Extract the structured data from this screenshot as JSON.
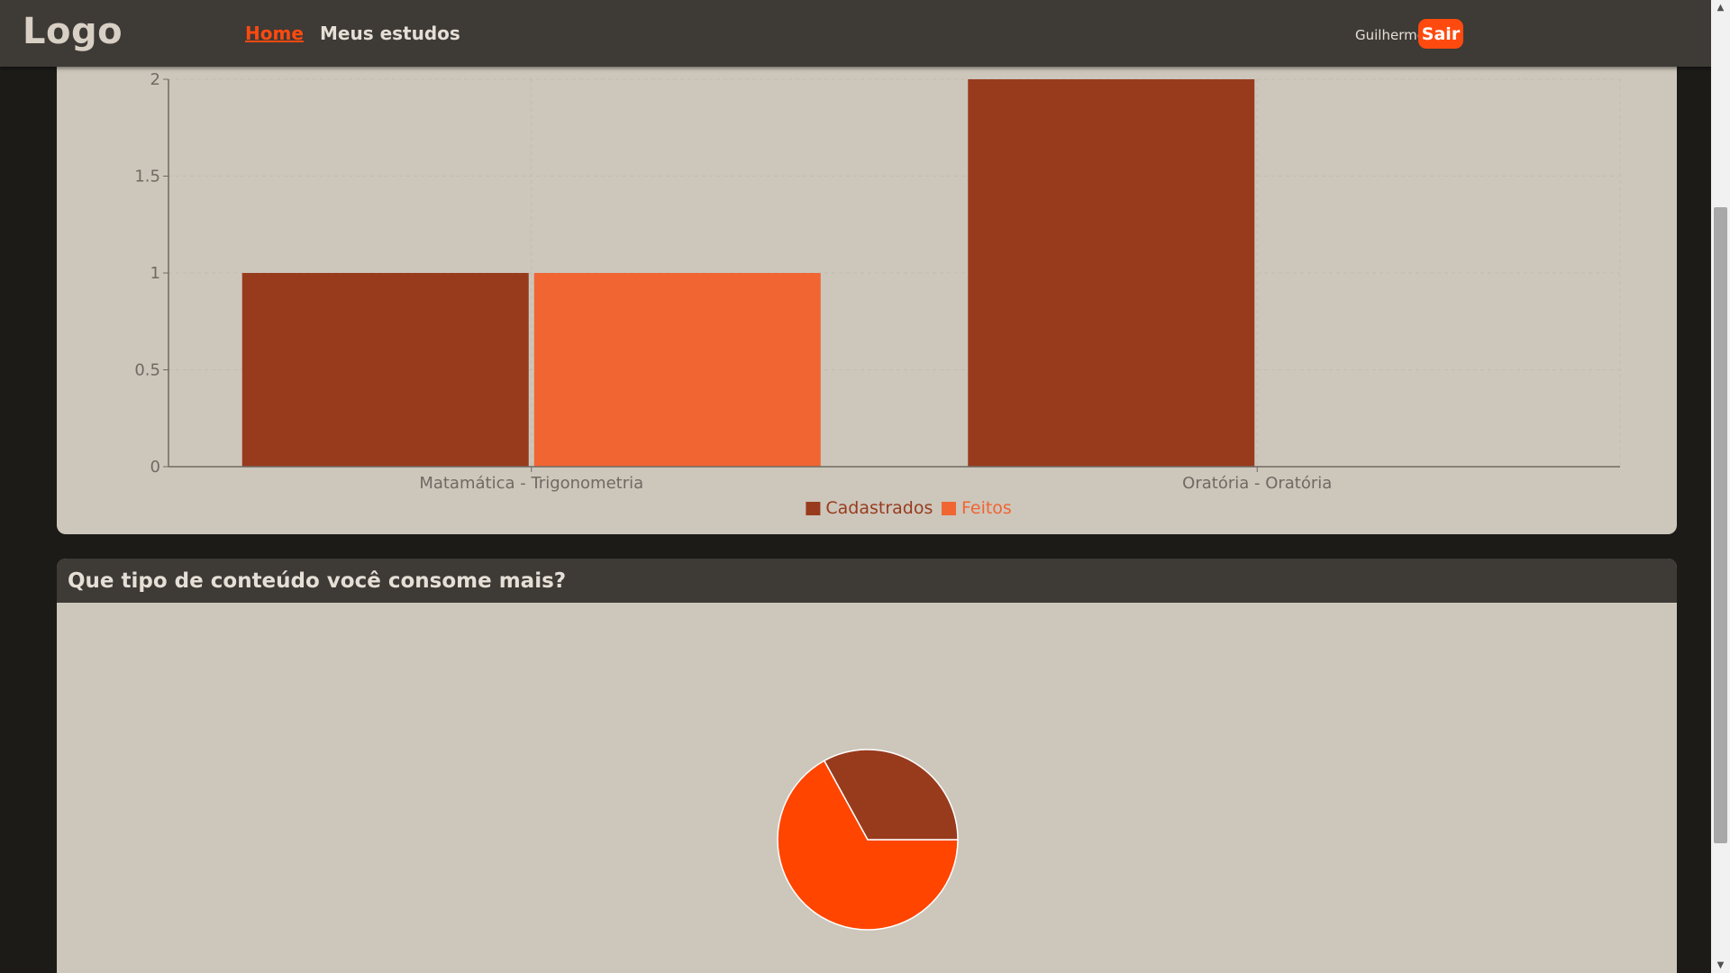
{
  "nav": {
    "logo": "Logo",
    "links": [
      {
        "label": "Home",
        "active": true
      },
      {
        "label": "Meus estudos",
        "active": false
      }
    ],
    "user_name": "Guilherme",
    "logout_label": "Sair"
  },
  "pie_card": {
    "title": "Que tipo de conteúdo você consome mais?"
  },
  "colors": {
    "cadastrados": "#983b1d",
    "feitos": "#f06532",
    "accent": "#ff4a0f",
    "pie_main": "#ff4500",
    "pie_secondary": "#983b1d"
  },
  "chart_data": [
    {
      "type": "bar",
      "categories": [
        "Matamática - Trigonometria",
        "Oratória - Oratória"
      ],
      "series": [
        {
          "name": "Cadastrados",
          "values": [
            1,
            2
          ]
        },
        {
          "name": "Feitos",
          "values": [
            1,
            0
          ]
        }
      ],
      "yticks": [
        "0",
        "0.5",
        "1",
        "1.5",
        "2"
      ],
      "ylim": [
        0,
        2
      ],
      "grid": true,
      "legend": "bottom-center"
    },
    {
      "type": "pie",
      "values": [
        67,
        33
      ]
    }
  ]
}
